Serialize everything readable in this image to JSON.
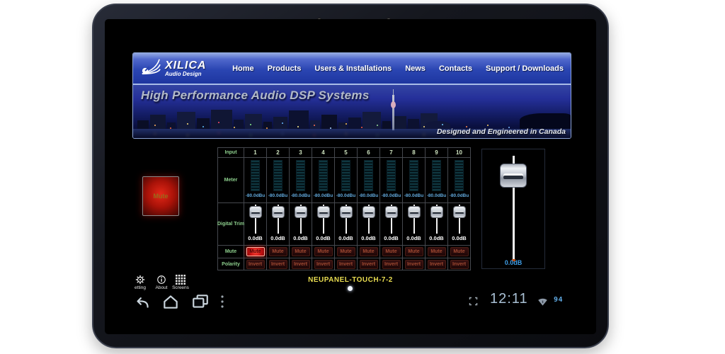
{
  "banner": {
    "brand": {
      "name": "XILICA",
      "tagline": "Audio Design"
    },
    "nav": [
      "Home",
      "Products",
      "Users & Installations",
      "News",
      "Contacts",
      "Support / Downloads"
    ],
    "headline": "High Performance Audio DSP Systems",
    "footer_note": "Designed and Engineered in Canada"
  },
  "left_panel": {
    "mute_button": "Mute"
  },
  "mixer": {
    "row_labels": {
      "input": "Input",
      "meter": "Meter",
      "trim": "Digital Trim",
      "mute": "Mute",
      "polarity": "Polarity"
    },
    "channels": [
      {
        "number": "1",
        "meter_db": "-80.0dBu",
        "trim_db": "0.0dB",
        "mute_label": "Mute",
        "mute_active": true,
        "polarity_label": "Invert",
        "polarity_active": false
      },
      {
        "number": "2",
        "meter_db": "-80.0dBu",
        "trim_db": "0.0dB",
        "mute_label": "Mute",
        "mute_active": false,
        "polarity_label": "Invert",
        "polarity_active": false
      },
      {
        "number": "3",
        "meter_db": "-80.0dBu",
        "trim_db": "0.0dB",
        "mute_label": "Mute",
        "mute_active": false,
        "polarity_label": "Invert",
        "polarity_active": false
      },
      {
        "number": "4",
        "meter_db": "-80.0dBu",
        "trim_db": "0.0dB",
        "mute_label": "Mute",
        "mute_active": false,
        "polarity_label": "Invert",
        "polarity_active": false
      },
      {
        "number": "5",
        "meter_db": "-80.0dBu",
        "trim_db": "0.0dB",
        "mute_label": "Mute",
        "mute_active": false,
        "polarity_label": "Invert",
        "polarity_active": false
      },
      {
        "number": "6",
        "meter_db": "-80.0dBu",
        "trim_db": "0.0dB",
        "mute_label": "Mute",
        "mute_active": false,
        "polarity_label": "Invert",
        "polarity_active": false
      },
      {
        "number": "7",
        "meter_db": "-80.0dBu",
        "trim_db": "0.0dB",
        "mute_label": "Mute",
        "mute_active": false,
        "polarity_label": "Invert",
        "polarity_active": false
      },
      {
        "number": "8",
        "meter_db": "-80.0dBu",
        "trim_db": "0.0dB",
        "mute_label": "Mute",
        "mute_active": false,
        "polarity_label": "Invert",
        "polarity_active": false
      },
      {
        "number": "9",
        "meter_db": "-80.0dBu",
        "trim_db": "0.0dB",
        "mute_label": "Mute",
        "mute_active": false,
        "polarity_label": "Invert",
        "polarity_active": false
      },
      {
        "number": "10",
        "meter_db": "-80.0dBu",
        "trim_db": "0.0dB",
        "mute_label": "Mute",
        "mute_active": false,
        "polarity_label": "Invert",
        "polarity_active": false
      }
    ]
  },
  "master": {
    "level_label": "0.0dB"
  },
  "footer": {
    "buttons": [
      {
        "icon": "gear-icon",
        "label": "etting"
      },
      {
        "icon": "info-icon",
        "label": "About"
      },
      {
        "icon": "grid-icon",
        "label": "Screens"
      }
    ],
    "device_name": "NEUPANEL-TOUCH-7-2"
  },
  "status_bar": {
    "time": "12:11",
    "battery": "94"
  },
  "colors": {
    "accent_blue": "#2a45b2",
    "mute_red": "#c51212",
    "meter_teal": "#0f3740",
    "db_blue": "#62aadd",
    "device_yellow": "#e8dc50",
    "label_green": "#8ed08e"
  }
}
